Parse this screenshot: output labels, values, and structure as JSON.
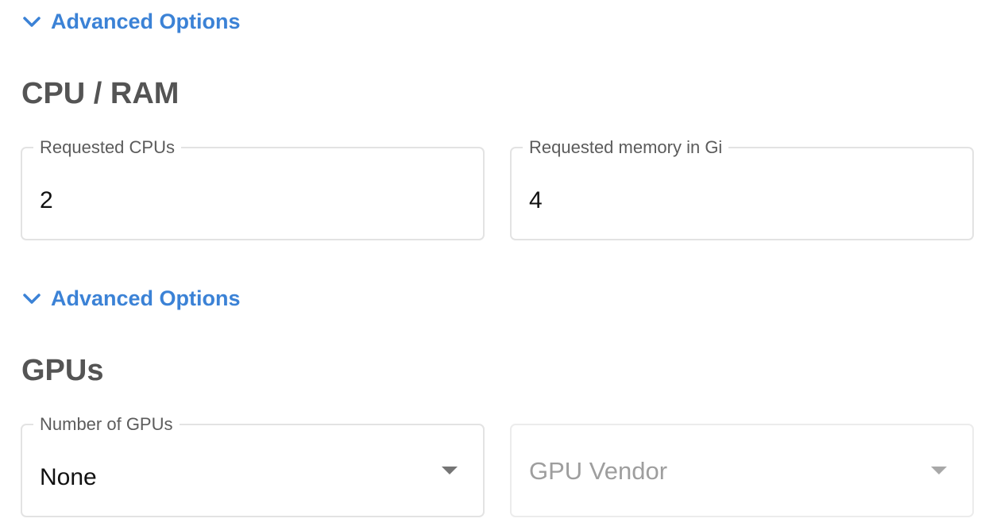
{
  "cpu_ram": {
    "advanced_toggle_label": "Advanced Options",
    "title": "CPU / RAM",
    "cpus": {
      "label": "Requested CPUs",
      "value": "2"
    },
    "memory": {
      "label": "Requested memory in Gi",
      "value": "4"
    }
  },
  "gpus": {
    "advanced_toggle_label": "Advanced Options",
    "title": "GPUs",
    "number": {
      "label": "Number of GPUs",
      "value": "None"
    },
    "vendor": {
      "placeholder": "GPU Vendor",
      "disabled": true
    }
  },
  "colors": {
    "accent": "#3b82d6",
    "heading": "#545454",
    "border": "#e3e3e3",
    "disabled_text": "#9e9e9e"
  },
  "icons": {
    "toggle": "chevron-down-icon",
    "select": "caret-down-icon"
  }
}
